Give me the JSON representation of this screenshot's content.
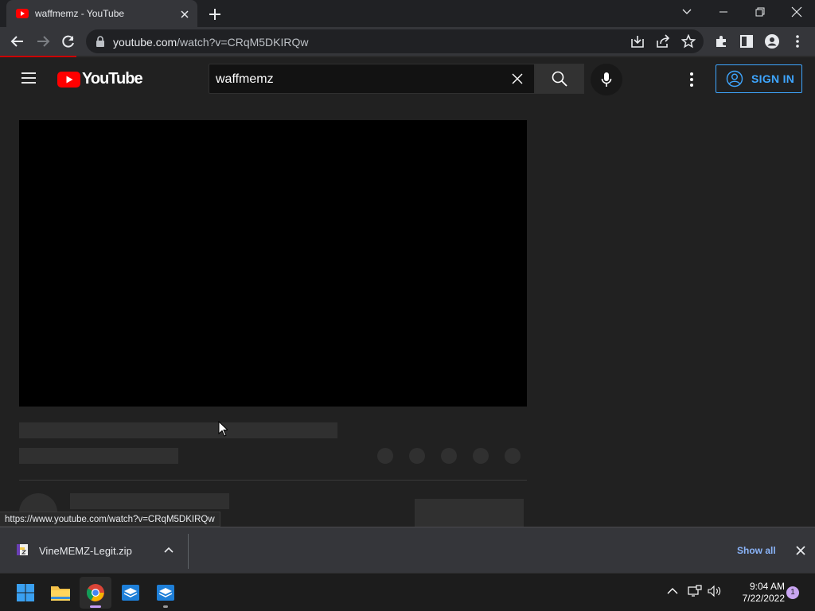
{
  "browser": {
    "tab_title": "waffmemz - YouTube",
    "url_host": "youtube.com",
    "url_path": "/watch?v=CRqM5DKIRQw",
    "status_url": "https://www.youtube.com/watch?v=CRqM5DKIRQw"
  },
  "youtube": {
    "logo_text": "YouTube",
    "search_value": "waffmemz",
    "sign_in_label": "SIGN IN"
  },
  "downloads": {
    "file_name": "VineMEMZ-Legit.zip",
    "show_all_label": "Show all"
  },
  "taskbar": {
    "time": "9:04 AM",
    "date": "7/22/2022",
    "notification_count": "1"
  },
  "colors": {
    "youtube_red": "#ff0000",
    "accent_blue": "#3ea6ff",
    "progress_red": "#cc0000"
  }
}
